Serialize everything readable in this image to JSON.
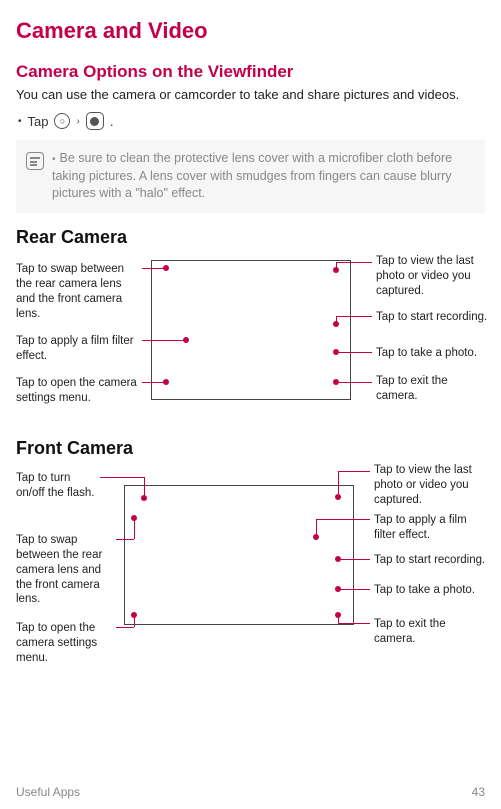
{
  "title": "Camera and Video",
  "section1_title": "Camera Options on the Viewfinder",
  "intro_text": "You can use the camera or camcorder to take and share pictures and videos.",
  "tap_label": "Tap",
  "chevron": "›",
  "note_text": "Be sure to clean the protective lens cover with a microfiber cloth before taking pictures. A lens cover with smudges from fingers can cause blurry pictures with a \"halo\" effect.",
  "rear_heading": "Rear Camera",
  "rear_left": [
    "Tap to swap between the rear camera lens and the front camera lens.",
    "Tap to apply a film filter effect.",
    "Tap to open the camera settings menu."
  ],
  "rear_right": [
    "Tap to view the last photo or video you captured.",
    "Tap to start recording.",
    "Tap to take a photo.",
    "Tap to exit the camera."
  ],
  "front_heading": "Front Camera",
  "front_left": [
    "Tap to turn on/off the flash.",
    "Tap to swap between the rear camera lens and the front camera lens.",
    "Tap to open the camera settings menu."
  ],
  "front_right": [
    "Tap to view the last photo or video you captured.",
    "Tap to apply a film filter effect.",
    "Tap to start recording.",
    "Tap to take a photo.",
    "Tap to exit the camera."
  ],
  "footer_section": "Useful Apps",
  "footer_page": "43"
}
